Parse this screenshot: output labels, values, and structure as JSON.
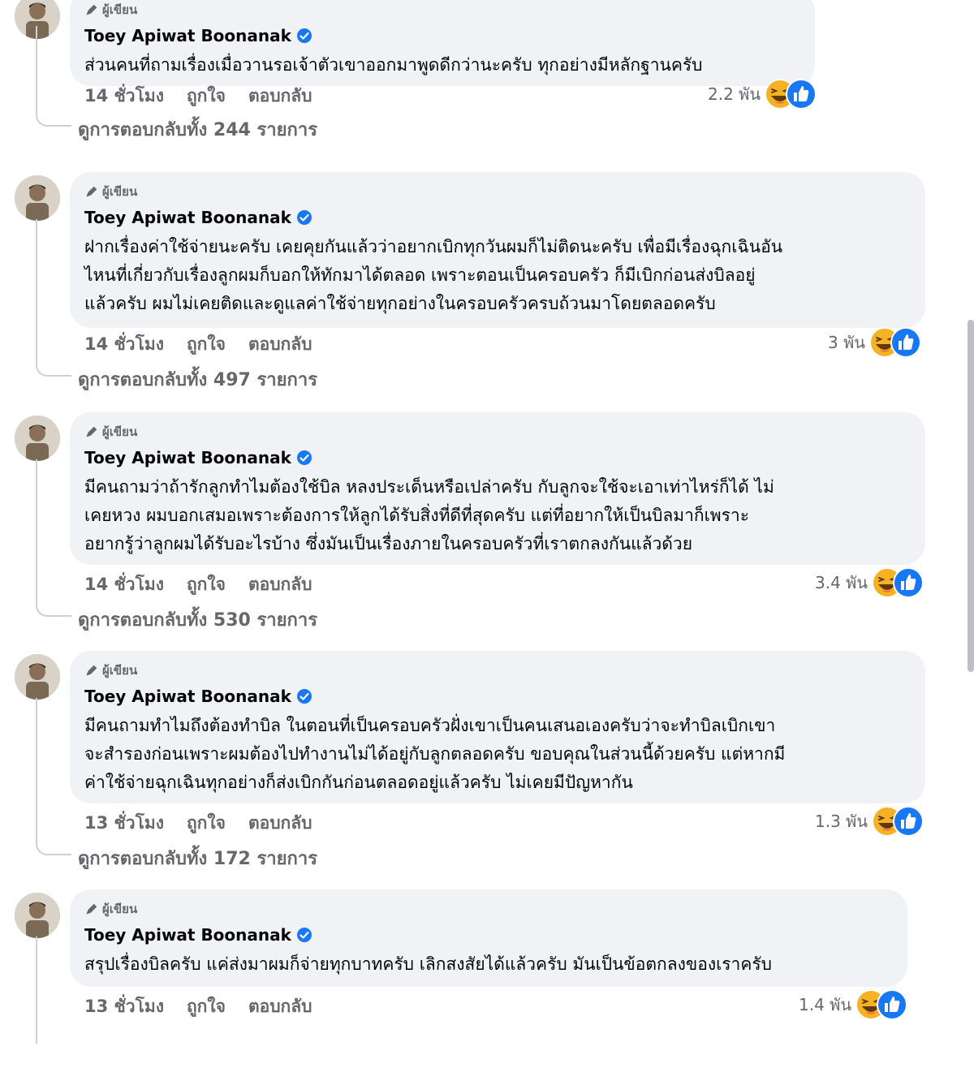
{
  "author_badge": "ผู้เขียน",
  "author_name": "Toey Apiwat Boonanak",
  "actions": {
    "like": "ถูกใจ",
    "reply": "ตอบกลับ"
  },
  "colors": {
    "bubble": "#f0f2f5",
    "muted": "#65676b",
    "verified": "#1877f2",
    "like": "#1877f2",
    "haha": "#f7b125"
  },
  "comments": [
    {
      "lines": [
        "ส่วนคนที่ถามเรื่องเมื่อวานรอเจ้าตัวเขาออกมาพูดดีกว่านะครับ ทุกอย่างมีหลักฐานครับ"
      ],
      "time": "14 ชั่วโมง",
      "reaction_count": "2.2 พัน",
      "view_replies": "ดูการตอบกลับทั้ง 244 รายการ",
      "reaction_icons": [
        "haha-icon",
        "like-icon"
      ]
    },
    {
      "lines": [
        "ฝากเรื่องค่าใช้จ่ายนะครับ เคยคุยกันแล้วว่าอยากเบิกทุกวันผมก็ไม่ติดนะครับ เพื่อมีเรื่องฉุกเฉินอัน",
        "ไหนที่เกี่ยวกับเรื่องลูกผมก็บอกให้ทักมาได้ตลอด เพราะตอนเป็นครอบครัว ก็มีเบิกก่อนส่งบิลอยู่",
        "แล้วครับ ผมไม่เคยติดและดูแลค่าใช้จ่ายทุกอย่างในครอบครัวครบถ้วนมาโดยตลอดครับ"
      ],
      "time": "14 ชั่วโมง",
      "reaction_count": "3 พัน",
      "view_replies": "ดูการตอบกลับทั้ง 497 รายการ",
      "reaction_icons": [
        "haha-icon",
        "like-icon"
      ]
    },
    {
      "lines": [
        "มีคนถามว่าถ้ารักลูกทำไมต้องใช้บิล หลงประเด็นหรือเปล่าครับ กับลูกจะใช้จะเอาเท่าไหร่ก็ได้ ไม่",
        "เคยหวง ผมบอกเสมอเพราะต้องการให้ลูกได้รับสิ่งที่ดีที่สุดครับ แต่ที่อยากให้เป็นบิลมาก็เพราะ",
        "อยากรู้ว่าลูกผมได้รับอะไรบ้าง ซึ่งมันเป็นเรื่องภายในครอบครัวที่เราตกลงกันแล้วด้วย"
      ],
      "time": "14 ชั่วโมง",
      "reaction_count": "3.4 พัน",
      "view_replies": "ดูการตอบกลับทั้ง 530 รายการ",
      "reaction_icons": [
        "haha-icon",
        "like-icon"
      ]
    },
    {
      "lines": [
        "มีคนถามทำไมถึงต้องทำบิล ในตอนที่เป็นครอบครัวฝั่งเขาเป็นคนเสนอเองครับว่าจะทำบิลเบิกเขา",
        "จะสำรองก่อนเพราะผมต้องไปทำงานไม่ได้อยู่กับลูกตลอดครับ ขอบคุณในส่วนนี้ด้วยครับ แต่หากมี",
        "ค่าใช้จ่ายฉุกเฉินทุกอย่างก็ส่งเบิกกันก่อนตลอดอยู่แล้วครับ ไม่เคยมีปัญหากัน"
      ],
      "time": "13 ชั่วโมง",
      "reaction_count": "1.3 พัน",
      "view_replies": "ดูการตอบกลับทั้ง 172 รายการ",
      "reaction_icons": [
        "haha-icon",
        "like-icon"
      ]
    },
    {
      "lines": [
        "สรุปเรื่องบิลครับ แค่ส่งมาผมก็จ่ายทุกบาทครับ เลิกสงสัยได้แล้วครับ มันเป็นข้อตกลงของเราครับ"
      ],
      "time": "13 ชั่วโมง",
      "reaction_count": "1.4 พัน",
      "view_replies": "",
      "reaction_icons": [
        "haha-icon",
        "like-icon"
      ]
    }
  ]
}
